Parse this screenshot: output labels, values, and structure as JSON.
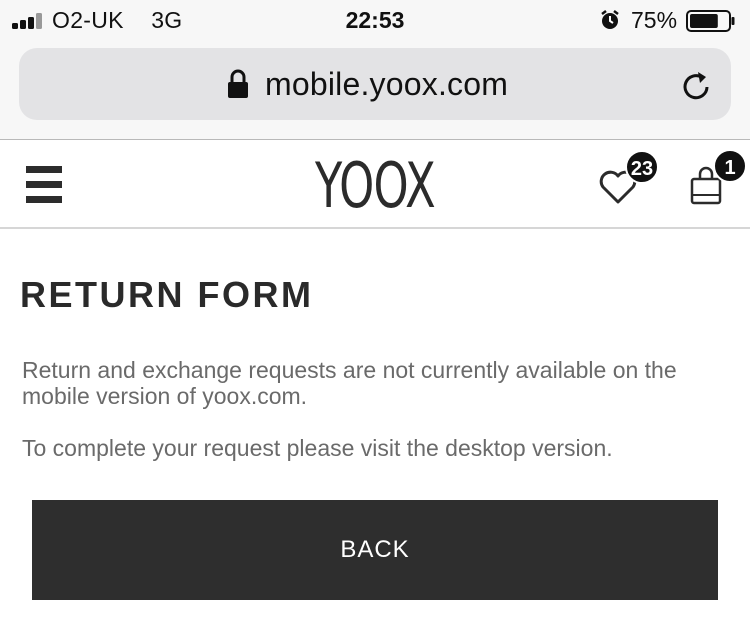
{
  "status_bar": {
    "carrier": "O2-UK",
    "network": "3G",
    "time": "22:53",
    "battery_percent": "75%",
    "battery_level": 0.75,
    "icons": [
      "signal-icon",
      "alarm-icon",
      "battery-icon"
    ]
  },
  "browser": {
    "url": "mobile.yoox.com",
    "icons": [
      "lock-icon",
      "reload-icon"
    ]
  },
  "header": {
    "logo": "YOOX",
    "wishlist_count": "23",
    "bag_count": "1",
    "icons": [
      "menu-icon",
      "heart-icon",
      "shopping-bag-icon"
    ]
  },
  "content": {
    "title": "RETURN FORM",
    "paragraph_1": "Return and exchange requests are not currently available on the mobile version of yoox.com.",
    "paragraph_2": "To complete your request please visit the desktop version.",
    "back_label": "BACK"
  },
  "colors": {
    "button_bg": "#2e2e2e",
    "body_text": "#6a6a6a",
    "title_text": "#2a2a2a",
    "url_field_bg": "#e3e3e5"
  }
}
